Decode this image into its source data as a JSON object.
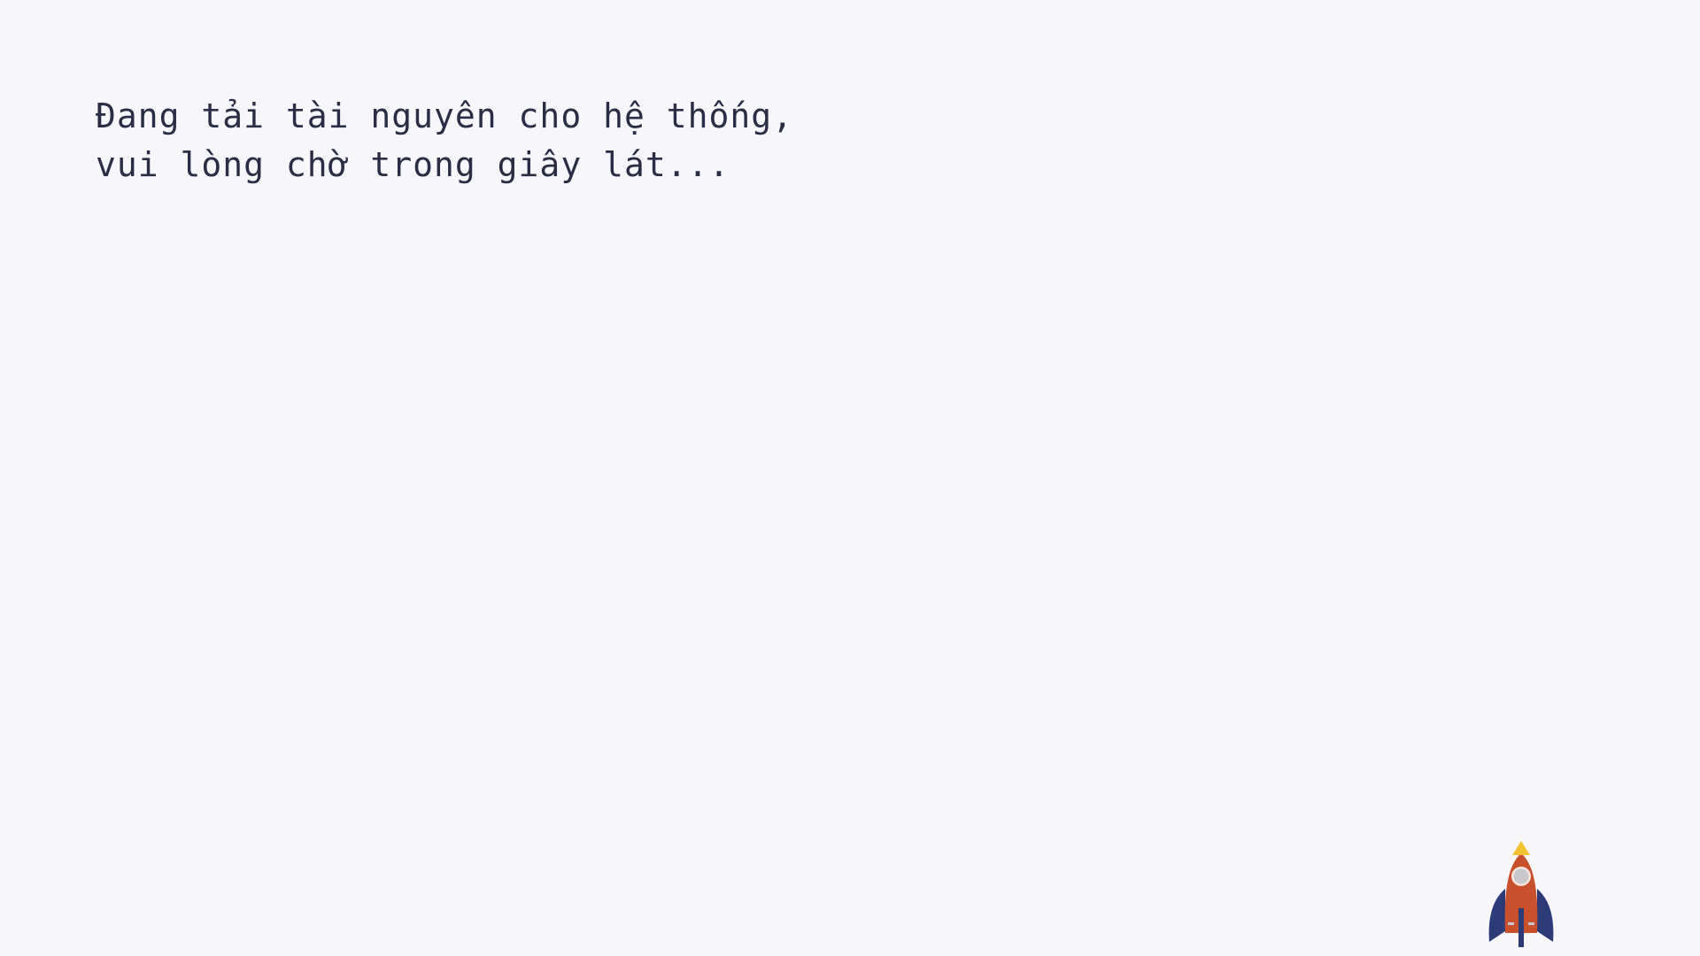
{
  "loading": {
    "line1": "Đang tải tài nguyên cho hệ thống,",
    "line2": "vui lòng chờ trong giây lát..."
  },
  "rocket": {
    "icon": "rocket-icon",
    "colors": {
      "body": "#c8502c",
      "fins": "#2c3a78",
      "nose": "#f2c230",
      "window": "#c8c8cc"
    }
  },
  "colors": {
    "background": "#f7f7fb",
    "text": "#2a2d45"
  }
}
